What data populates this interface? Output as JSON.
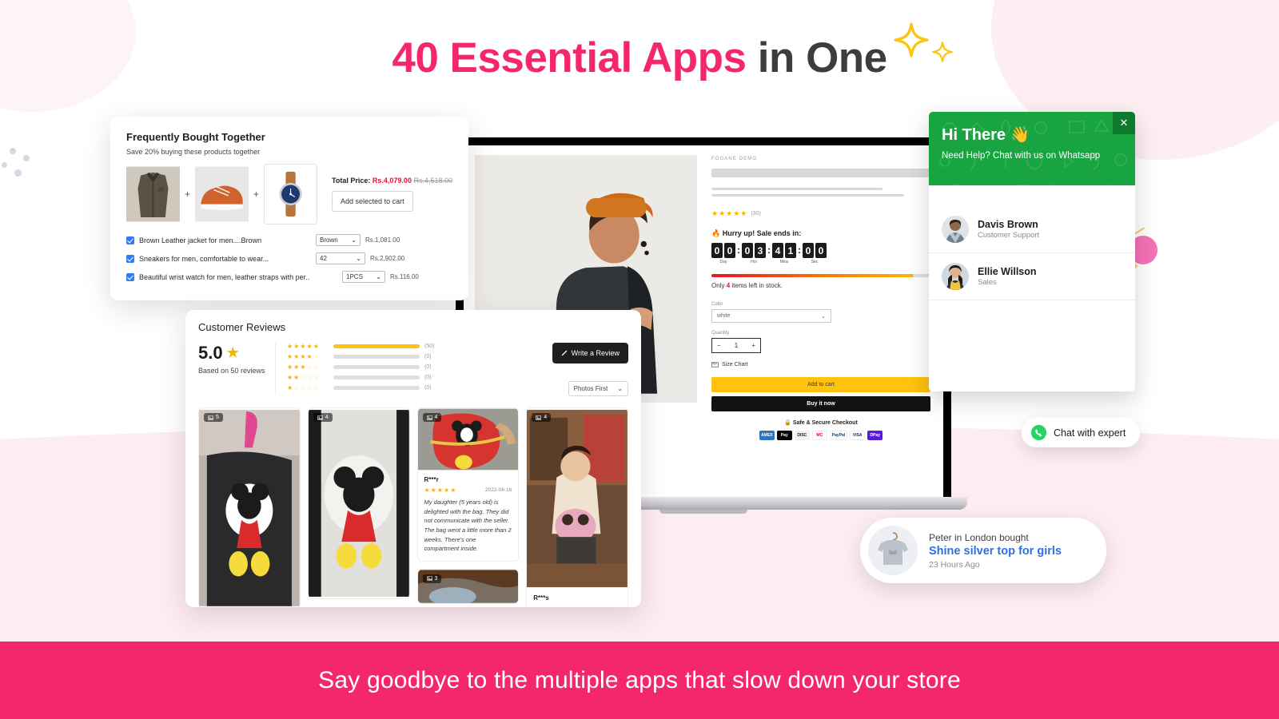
{
  "headline": {
    "accent": "40 Essential Apps",
    "rest": " in One"
  },
  "banner": {
    "text": "Say goodbye to the multiple apps that slow down your store"
  },
  "colors": {
    "brand_pink": "#f5276b",
    "whatsapp_green": "#18a440",
    "accent_yellow": "#ffc20e",
    "link_blue": "#2f6fe4",
    "sale_red": "#e8112d"
  },
  "fbt": {
    "title": "Frequently Bought Together",
    "subtitle": "Save 20% buying these products together",
    "plus": "+",
    "total_label": "Total Price:",
    "total_new": "Rs.4,079.00",
    "total_old": "Rs.4,518.00",
    "add_button": "Add selected to cart",
    "items": [
      {
        "name": "Brown Leather jacket for men....Brown",
        "variant": "Brown",
        "price": "Rs.1,081.00"
      },
      {
        "name": "Sneakers for men, comfortable to wear...",
        "variant": "42",
        "price": "Rs.2,902.00"
      },
      {
        "name": "Beautiful wrist watch for men, leather straps with per..",
        "variant": "1PCS",
        "price": "Rs.116.00"
      }
    ]
  },
  "reviews": {
    "title": "Customer Reviews",
    "score": "5.0",
    "based_on": "Based on 50 reviews",
    "write_button": "Write a Review",
    "sort_value": "Photos First",
    "bars": [
      {
        "stars": 5,
        "count": "(50)",
        "pct": 100
      },
      {
        "stars": 4,
        "count": "(0)",
        "pct": 0
      },
      {
        "stars": 3,
        "count": "(0)",
        "pct": 0
      },
      {
        "stars": 2,
        "count": "(0)",
        "pct": 0
      },
      {
        "stars": 1,
        "count": "(0)",
        "pct": 0
      }
    ],
    "cards": [
      {
        "photos": "5",
        "name": "",
        "date": "",
        "text": ""
      },
      {
        "photos": "4",
        "name": "",
        "date": "",
        "text": ""
      },
      {
        "photos": "4",
        "name": "R***r",
        "date": "2022-06-16",
        "stars": "★★★★★",
        "text": "My daughter (5 years old) is delighted with the bag. They did not communicate with the seller. The bag went a little more than 2 weeks. There's one compartment inside."
      },
      {
        "photos": "3",
        "name": "",
        "date": "",
        "text": ""
      },
      {
        "photos": "4",
        "name": "R***s",
        "date": "",
        "text": ""
      }
    ]
  },
  "pdp": {
    "brand": "FOGANE DEMO",
    "rating_stars": "★★★★★",
    "rating_count": "(30)",
    "hurry": "Hurry up! Sale ends in:",
    "timer": {
      "digits": [
        "0",
        "0",
        "0",
        "3",
        "4",
        "1",
        "0",
        "0"
      ],
      "labels": [
        "Day",
        "Hrs",
        "Mins",
        "Sec"
      ],
      "separator": ":"
    },
    "stock_prefix": "Only",
    "stock_count": "4",
    "stock_suffix": "items left in stock.",
    "color_label": "Color",
    "color_value": "white",
    "quantity_label": "Quantity",
    "quantity_value": "1",
    "qty_minus": "−",
    "qty_plus": "+",
    "size_chart": "Size Chart",
    "add_to_cart": "Add to cart",
    "buy_now": "Buy it now",
    "secure": "Safe & Secure Checkout",
    "payments": [
      {
        "label": "AMEX",
        "bg": "#2e77bc",
        "fg": "#ffffff"
      },
      {
        "label": "Pay",
        "bg": "#000000",
        "fg": "#ffffff"
      },
      {
        "label": "DISC",
        "bg": "#f2f2f2",
        "fg": "#222222"
      },
      {
        "label": "MC",
        "bg": "#ffffff",
        "fg": "#eb001b"
      },
      {
        "label": "PayPal",
        "bg": "#ffffff",
        "fg": "#00457c"
      },
      {
        "label": "VISA",
        "bg": "#ffffff",
        "fg": "#1a1f71"
      },
      {
        "label": "DPay",
        "bg": "#5b1ae0",
        "fg": "#ffffff"
      }
    ],
    "carousel_arrow": "›"
  },
  "whatsapp": {
    "title": "Hi There",
    "wave": "👋",
    "subtitle": "Need Help? Chat with us on Whatsapp",
    "close": "✕",
    "agents": [
      {
        "name": "Davis Brown",
        "role": "Customer Support"
      },
      {
        "name": "Ellie Willson",
        "role": "Sales"
      }
    ],
    "pill_label": "Chat with expert"
  },
  "notification": {
    "line1": "Peter in London bought",
    "product": "Shine silver top for girls",
    "time": "23 Hours Ago"
  }
}
